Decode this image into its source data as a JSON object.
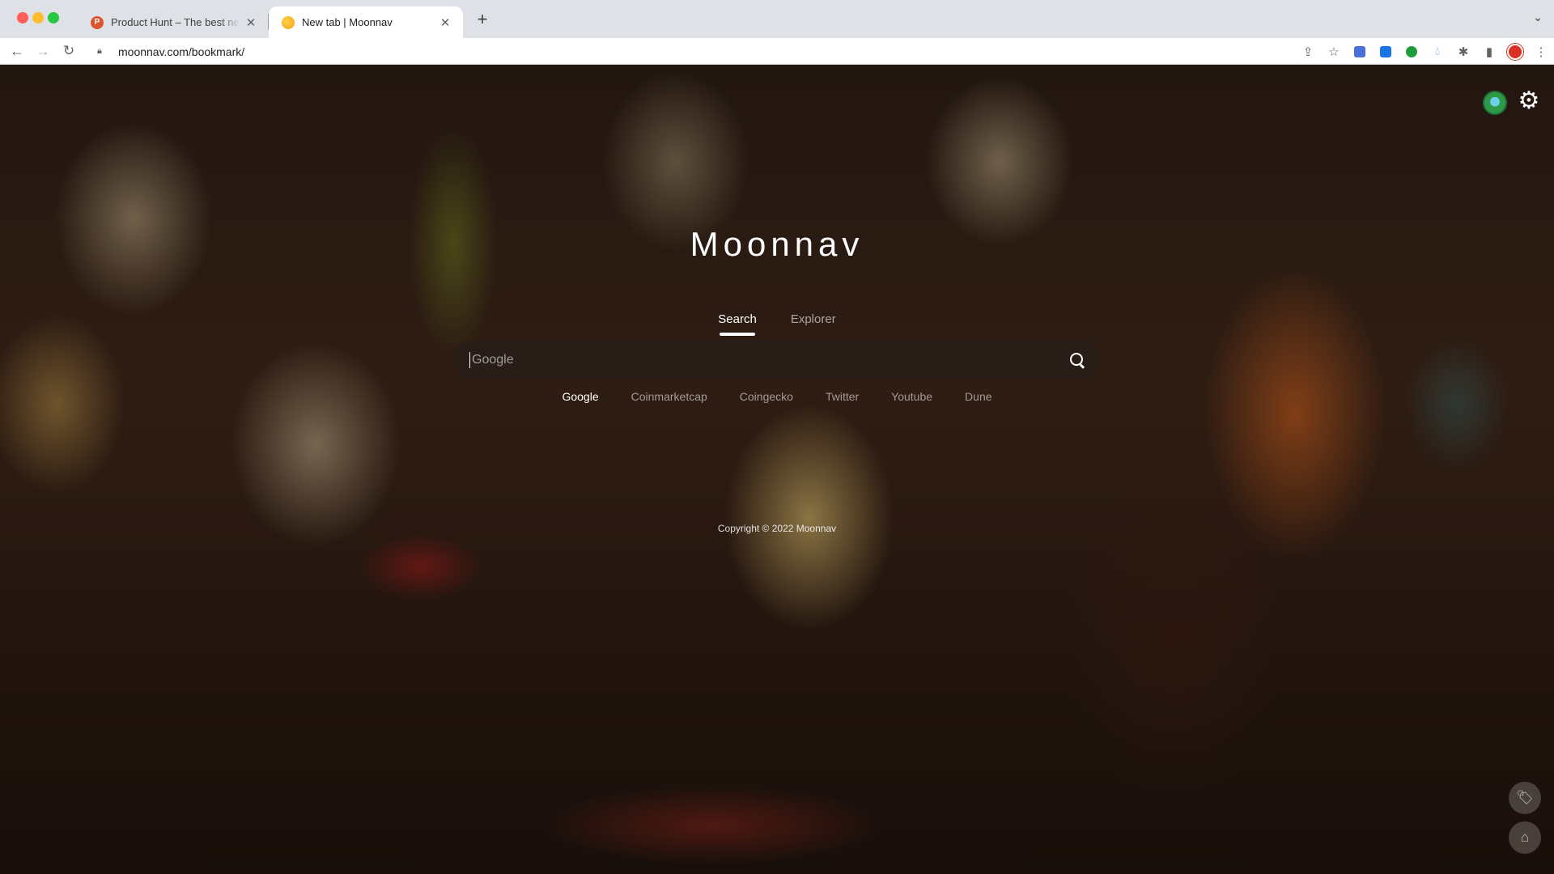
{
  "browser": {
    "tabs": [
      {
        "title": "Product Hunt – The best new products in tech.",
        "favicon_letter": "P",
        "active": false
      },
      {
        "title": "New tab | Moonnav",
        "active": true
      }
    ],
    "url": "moonnav.com/bookmark/"
  },
  "page": {
    "brand": "Moonnav",
    "mode_tabs": [
      "Search",
      "Explorer"
    ],
    "search": {
      "placeholder": "Google",
      "value": ""
    },
    "engines": [
      "Google",
      "Coinmarketcap",
      "Coingecko",
      "Twitter",
      "Youtube",
      "Dune"
    ],
    "copyright": "Copyright © 2022 Moonnav"
  },
  "icons": {
    "search": "search-icon",
    "settings": "gear-icon",
    "tag": "tag-icon",
    "home": "home-icon"
  },
  "colors": {
    "chrome_bg": "#dee1e6",
    "active_tab_bg": "#ffffff",
    "search_bar_bg": "#281e19",
    "text_on_bg": "#ffffff"
  }
}
